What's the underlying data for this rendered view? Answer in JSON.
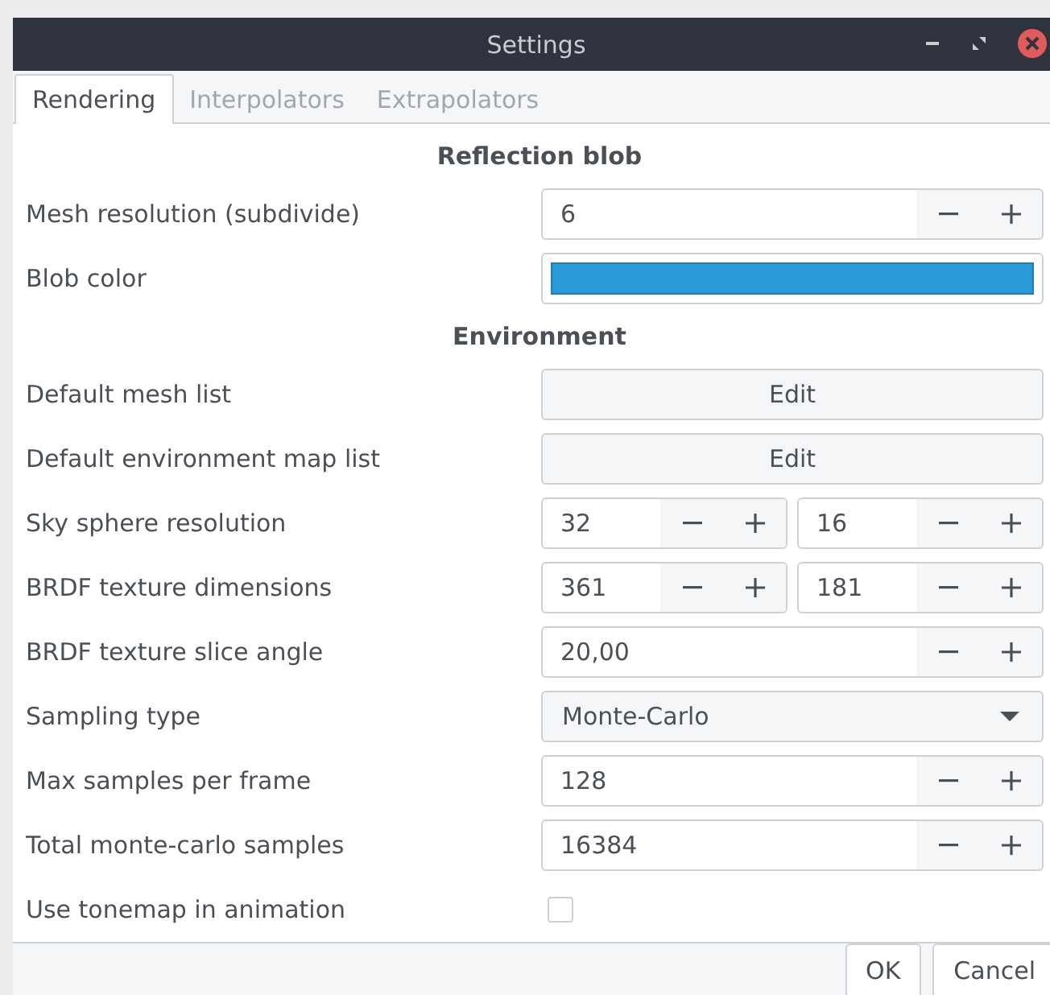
{
  "window": {
    "title": "Settings"
  },
  "tabs": [
    {
      "label": "Rendering",
      "selected": true
    },
    {
      "label": "Interpolators",
      "selected": false
    },
    {
      "label": "Extrapolators",
      "selected": false
    }
  ],
  "rows": [
    {
      "kind": "section",
      "label": "Reflection blob"
    },
    {
      "kind": "spin",
      "label": "Mesh resolution (subdivide)",
      "values": [
        "6"
      ]
    },
    {
      "kind": "color",
      "label": "Blob color",
      "color": "#2a9ad6"
    },
    {
      "kind": "section",
      "label": "Environment"
    },
    {
      "kind": "button",
      "label": "Default mesh list",
      "button": "Edit"
    },
    {
      "kind": "button",
      "label": "Default environment map list",
      "button": "Edit"
    },
    {
      "kind": "spin",
      "label": "Sky sphere resolution",
      "values": [
        "32",
        "16"
      ]
    },
    {
      "kind": "spin",
      "label": "BRDF texture dimensions",
      "values": [
        "361",
        "181"
      ]
    },
    {
      "kind": "spin",
      "label": "BRDF texture slice angle",
      "values": [
        "20,00"
      ]
    },
    {
      "kind": "combo",
      "label": "Sampling type",
      "value": "Monte-Carlo"
    },
    {
      "kind": "spin",
      "label": "Max samples per frame",
      "values": [
        "128"
      ]
    },
    {
      "kind": "spin",
      "label": "Total monte-carlo samples",
      "values": [
        "16384"
      ]
    },
    {
      "kind": "checkbox",
      "label": "Use tonemap in animation",
      "checked": false
    }
  ],
  "buttons": [
    "OK",
    "Cancel"
  ]
}
